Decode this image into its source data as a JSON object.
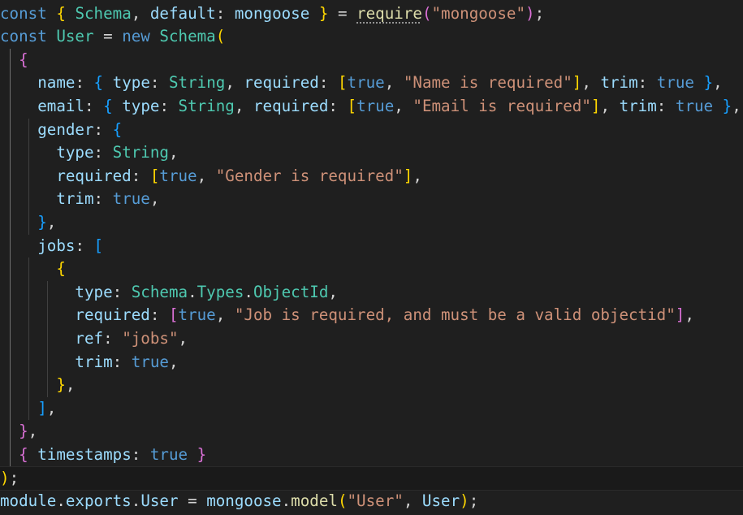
{
  "editor": {
    "language": "javascript",
    "theme": "dark",
    "colors": {
      "background": "#1f1f1f",
      "keyword": "#569cd6",
      "variable": "#9cdcfe",
      "type": "#4ec9b0",
      "function": "#dcdcaa",
      "string": "#ce9178",
      "punctuation": "#d4d4d4",
      "bracket_gold": "#ffd700",
      "bracket_pink": "#da70d6",
      "bracket_blue": "#179fff",
      "indent_guide": "#404040"
    },
    "lines": [
      [
        [
          "kw",
          "const"
        ],
        [
          "p",
          " "
        ],
        [
          "b1",
          "{"
        ],
        [
          "p",
          " "
        ],
        [
          "ty",
          "Schema"
        ],
        [
          "p",
          ", "
        ],
        [
          "var",
          "default"
        ],
        [
          "p",
          ": "
        ],
        [
          "var",
          "mongoose"
        ],
        [
          "p",
          " "
        ],
        [
          "b1",
          "}"
        ],
        [
          "p",
          " = "
        ],
        [
          "fnsq",
          "require"
        ],
        [
          "b2",
          "("
        ],
        [
          "str",
          "\"mongoose\""
        ],
        [
          "b2",
          ")"
        ],
        [
          "p",
          ";"
        ]
      ],
      [
        [
          "kw",
          "const"
        ],
        [
          "p",
          " "
        ],
        [
          "ty",
          "User"
        ],
        [
          "p",
          " = "
        ],
        [
          "kw",
          "new"
        ],
        [
          "p",
          " "
        ],
        [
          "ty",
          "Schema"
        ],
        [
          "b1",
          "("
        ]
      ],
      [
        [
          "p",
          "  "
        ],
        [
          "b2",
          "{"
        ]
      ],
      [
        [
          "p",
          "    "
        ],
        [
          "var",
          "name"
        ],
        [
          "p",
          ": "
        ],
        [
          "b3",
          "{"
        ],
        [
          "p",
          " "
        ],
        [
          "var",
          "type"
        ],
        [
          "p",
          ": "
        ],
        [
          "ty",
          "String"
        ],
        [
          "p",
          ", "
        ],
        [
          "var",
          "required"
        ],
        [
          "p",
          ": "
        ],
        [
          "b1",
          "["
        ],
        [
          "kw",
          "true"
        ],
        [
          "p",
          ", "
        ],
        [
          "str",
          "\"Name is required\""
        ],
        [
          "b1",
          "]"
        ],
        [
          "p",
          ", "
        ],
        [
          "var",
          "trim"
        ],
        [
          "p",
          ": "
        ],
        [
          "kw",
          "true"
        ],
        [
          "p",
          " "
        ],
        [
          "b3",
          "}"
        ],
        [
          "p",
          ","
        ]
      ],
      [
        [
          "p",
          "    "
        ],
        [
          "var",
          "email"
        ],
        [
          "p",
          ": "
        ],
        [
          "b3",
          "{"
        ],
        [
          "p",
          " "
        ],
        [
          "var",
          "type"
        ],
        [
          "p",
          ": "
        ],
        [
          "ty",
          "String"
        ],
        [
          "p",
          ", "
        ],
        [
          "var",
          "required"
        ],
        [
          "p",
          ": "
        ],
        [
          "b1",
          "["
        ],
        [
          "kw",
          "true"
        ],
        [
          "p",
          ", "
        ],
        [
          "str",
          "\"Email is required\""
        ],
        [
          "b1",
          "]"
        ],
        [
          "p",
          ", "
        ],
        [
          "var",
          "trim"
        ],
        [
          "p",
          ": "
        ],
        [
          "kw",
          "true"
        ],
        [
          "p",
          " "
        ],
        [
          "b3",
          "}"
        ],
        [
          "p",
          ","
        ]
      ],
      [
        [
          "p",
          "    "
        ],
        [
          "var",
          "gender"
        ],
        [
          "p",
          ": "
        ],
        [
          "b3",
          "{"
        ]
      ],
      [
        [
          "p",
          "      "
        ],
        [
          "var",
          "type"
        ],
        [
          "p",
          ": "
        ],
        [
          "ty",
          "String"
        ],
        [
          "p",
          ","
        ]
      ],
      [
        [
          "p",
          "      "
        ],
        [
          "var",
          "required"
        ],
        [
          "p",
          ": "
        ],
        [
          "b1",
          "["
        ],
        [
          "kw",
          "true"
        ],
        [
          "p",
          ", "
        ],
        [
          "str",
          "\"Gender is required\""
        ],
        [
          "b1",
          "]"
        ],
        [
          "p",
          ","
        ]
      ],
      [
        [
          "p",
          "      "
        ],
        [
          "var",
          "trim"
        ],
        [
          "p",
          ": "
        ],
        [
          "kw",
          "true"
        ],
        [
          "p",
          ","
        ]
      ],
      [
        [
          "p",
          "    "
        ],
        [
          "b3",
          "}"
        ],
        [
          "p",
          ","
        ]
      ],
      [
        [
          "p",
          "    "
        ],
        [
          "var",
          "jobs"
        ],
        [
          "p",
          ": "
        ],
        [
          "b3",
          "["
        ]
      ],
      [
        [
          "p",
          "      "
        ],
        [
          "b1",
          "{"
        ]
      ],
      [
        [
          "p",
          "        "
        ],
        [
          "var",
          "type"
        ],
        [
          "p",
          ": "
        ],
        [
          "ty",
          "Schema"
        ],
        [
          "p",
          "."
        ],
        [
          "ty",
          "Types"
        ],
        [
          "p",
          "."
        ],
        [
          "ty",
          "ObjectId"
        ],
        [
          "p",
          ","
        ]
      ],
      [
        [
          "p",
          "        "
        ],
        [
          "var",
          "required"
        ],
        [
          "p",
          ": "
        ],
        [
          "b2",
          "["
        ],
        [
          "kw",
          "true"
        ],
        [
          "p",
          ", "
        ],
        [
          "str",
          "\"Job is required, and must be a valid objectid\""
        ],
        [
          "b2",
          "]"
        ],
        [
          "p",
          ","
        ]
      ],
      [
        [
          "p",
          "        "
        ],
        [
          "var",
          "ref"
        ],
        [
          "p",
          ": "
        ],
        [
          "str",
          "\"jobs\""
        ],
        [
          "p",
          ","
        ]
      ],
      [
        [
          "p",
          "        "
        ],
        [
          "var",
          "trim"
        ],
        [
          "p",
          ": "
        ],
        [
          "kw",
          "true"
        ],
        [
          "p",
          ","
        ]
      ],
      [
        [
          "p",
          "      "
        ],
        [
          "b1",
          "}"
        ],
        [
          "p",
          ","
        ]
      ],
      [
        [
          "p",
          "    "
        ],
        [
          "b3",
          "]"
        ],
        [
          "p",
          ","
        ]
      ],
      [
        [
          "p",
          "  "
        ],
        [
          "b2",
          "}"
        ],
        [
          "p",
          ","
        ]
      ],
      [
        [
          "p",
          "  "
        ],
        [
          "b2",
          "{"
        ],
        [
          "p",
          " "
        ],
        [
          "var",
          "timestamps"
        ],
        [
          "p",
          ": "
        ],
        [
          "kw",
          "true"
        ],
        [
          "p",
          " "
        ],
        [
          "b2",
          "}"
        ]
      ],
      [
        [
          "b1",
          ")"
        ],
        [
          "p",
          ";"
        ]
      ],
      [
        [
          "var",
          "module"
        ],
        [
          "p",
          "."
        ],
        [
          "var",
          "exports"
        ],
        [
          "p",
          "."
        ],
        [
          "var",
          "User"
        ],
        [
          "p",
          " = "
        ],
        [
          "var",
          "mongoose"
        ],
        [
          "p",
          "."
        ],
        [
          "fn",
          "model"
        ],
        [
          "b1",
          "("
        ],
        [
          "str",
          "\"User\""
        ],
        [
          "p",
          ", "
        ],
        [
          "var",
          "User"
        ],
        [
          "b1",
          ")"
        ],
        [
          "p",
          ";"
        ]
      ]
    ],
    "current_line": 20
  }
}
